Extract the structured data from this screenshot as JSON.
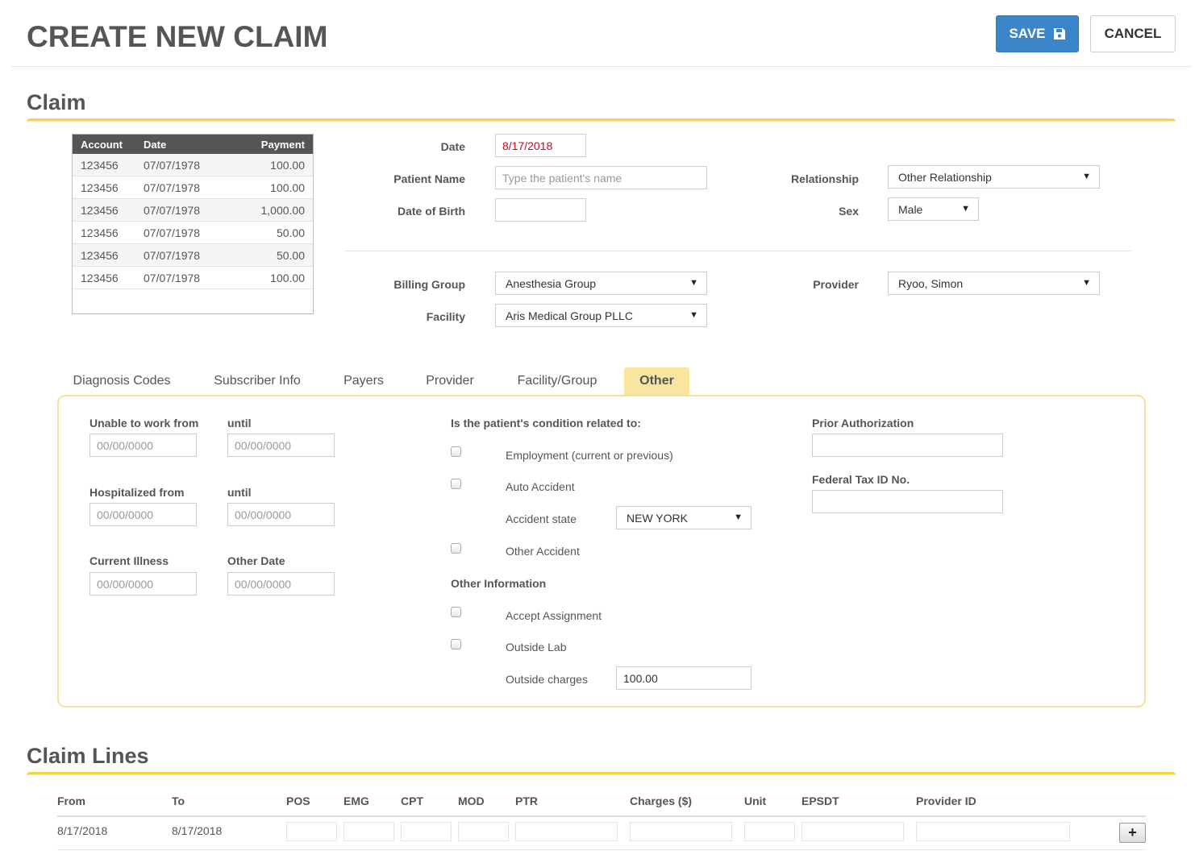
{
  "page_title": "CREATE NEW CLAIM",
  "header": {
    "save_label": "SAVE",
    "cancel_label": "CANCEL"
  },
  "claim_section": {
    "title": "Claim"
  },
  "payments_table": {
    "headers": [
      "Account",
      "Date",
      "Payment"
    ],
    "rows": [
      [
        "123456",
        "07/07/1978",
        "100.00"
      ],
      [
        "123456",
        "07/07/1978",
        "100.00"
      ],
      [
        "123456",
        "07/07/1978",
        "1,000.00"
      ],
      [
        "123456",
        "07/07/1978",
        "50.00"
      ],
      [
        "123456",
        "07/07/1978",
        "50.00"
      ],
      [
        "123456",
        "07/07/1978",
        "100.00"
      ]
    ]
  },
  "claim_form": {
    "date_label": "Date",
    "date_value": "8/17/2018",
    "patient_name_label": "Patient Name",
    "patient_name_placeholder": "Type the patient's name",
    "dob_label": "Date of Birth",
    "relationship_label": "Relationship",
    "relationship_value": "Other Relationship",
    "sex_label": "Sex",
    "sex_value": "Male",
    "billing_group_label": "Billing Group",
    "billing_group_value": "Anesthesia Group",
    "facility_label": "Facility",
    "facility_value": "Aris Medical Group PLLC",
    "provider_label": "Provider",
    "provider_value": "Ryoo, Simon"
  },
  "tabs": [
    "Diagnosis Codes",
    "Subscriber Info",
    "Payers",
    "Provider",
    "Facility/Group",
    "Other"
  ],
  "other_tab": {
    "unable_from_label": "Unable to work from",
    "unable_until_label": "until",
    "hosp_from_label": "Hospitalized from",
    "hosp_until_label": "until",
    "current_illness_label": "Current Illness",
    "other_date_label": "Other Date",
    "date_placeholder": "00/00/0000",
    "condition_label": "Is the patient's condition related to:",
    "employment_label": "Employment (current or previous)",
    "auto_accident_label": "Auto Accident",
    "accident_state_label": "Accident state",
    "accident_state_value": "NEW YORK",
    "other_accident_label": "Other Accident",
    "other_info_label": "Other Information",
    "accept_assignment_label": "Accept Assignment",
    "outside_lab_label": "Outside Lab",
    "outside_charges_label": "Outside charges",
    "outside_charges_value": "100.00",
    "prior_auth_label": "Prior Authorization",
    "fed_tax_label": "Federal Tax ID No."
  },
  "claim_lines": {
    "title": "Claim Lines",
    "headers": [
      "From",
      "To",
      "POS",
      "EMG",
      "CPT",
      "MOD",
      "PTR",
      "Charges ($)",
      "Unit",
      "EPSDT",
      "Provider ID"
    ],
    "row": {
      "from": "8/17/2018",
      "to": "8/17/2018"
    },
    "add_label": "+"
  }
}
